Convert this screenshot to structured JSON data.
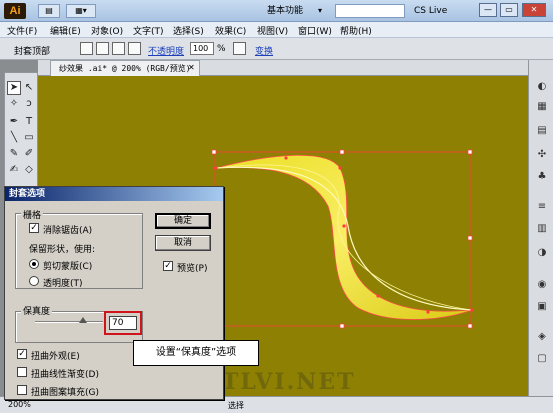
{
  "titlebar": {
    "logo": "Ai",
    "workspace": "基本功能",
    "cs_live": "CS Live",
    "win_min": "—",
    "win_max": "▭",
    "win_close": "✕"
  },
  "menu": [
    "文件(F)",
    "编辑(E)",
    "对象(O)",
    "文字(T)",
    "选择(S)",
    "效果(C)",
    "视图(V)",
    "窗口(W)",
    "帮助(H)"
  ],
  "control": {
    "label": "封套顶部",
    "opacity_link": "不透明度",
    "opacity_value": "100",
    "opacity_unit": "%",
    "transform_link": "变换"
  },
  "document": {
    "tab_title": "纱效果 .ai* @ 200% (RGB/预览)",
    "close": "✕"
  },
  "dialog": {
    "title": "封套选项",
    "group_grid": "栅格",
    "antialias_label": "消除锯齿(A)",
    "antialias_checked": true,
    "preserve_shape_label": "保留形状，使用:",
    "clip_mask_label": "剪切蒙版(C)",
    "transparency_label": "透明度(T)",
    "fidelity_group": "保真度",
    "fidelity_value": "70",
    "fidelity_fraction": 0.7,
    "ok": "确定",
    "cancel": "取消",
    "preview_label": "预览(P)",
    "preview_checked": true,
    "distort_appearance": "扭曲外观(E)",
    "distort_appearance_checked": true,
    "distort_linear_gradient": "扭曲线性渐变(D)",
    "distort_pattern_fill": "扭曲图案填充(G)"
  },
  "callout": "设置“保真度”选项",
  "status": {
    "zoom": "200%",
    "mode": "选择"
  },
  "watermark": "飞特视觉 WWW.TLVI.NET",
  "colors": {
    "canvas": "#8d8002",
    "selection": "#ff3c3c",
    "artwork": "#f5ea2a",
    "highlight": "#d0141c"
  }
}
